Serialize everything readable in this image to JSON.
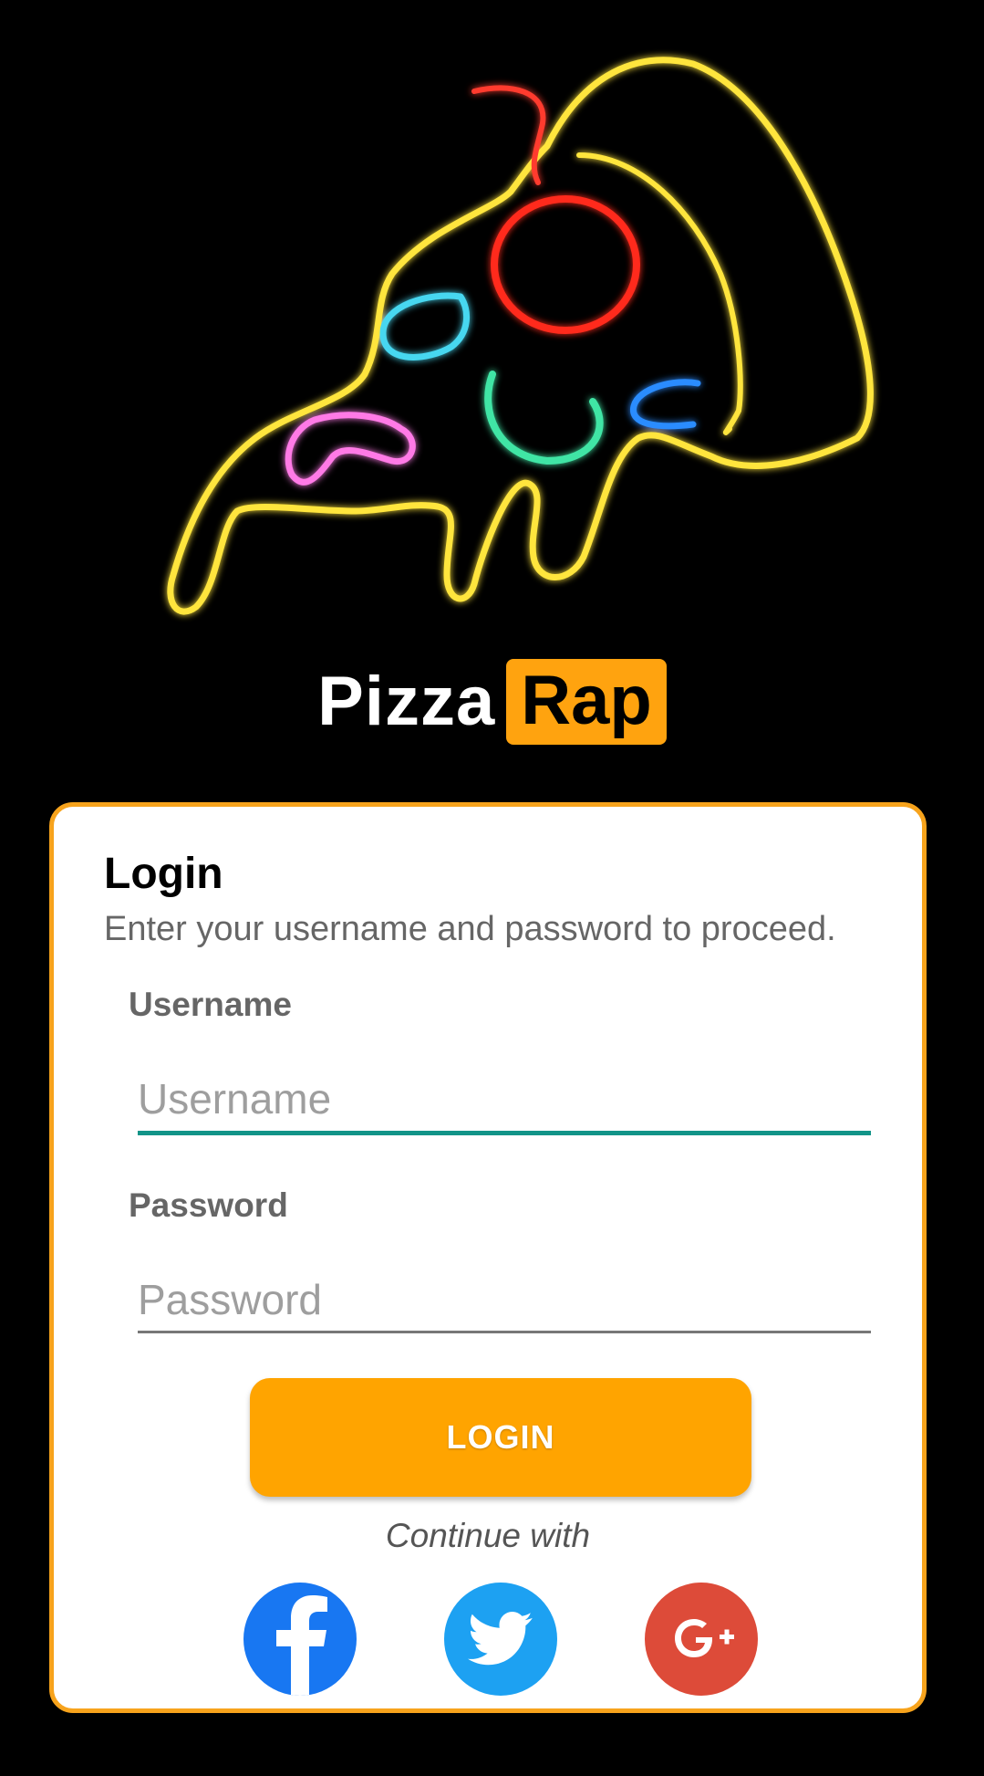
{
  "brand": {
    "word1": "Pizza",
    "word2": "Rap",
    "accent_color": "#ffa30f"
  },
  "login": {
    "title": "Login",
    "subtitle": "Enter your username and password to proceed.",
    "username_label": "Username",
    "username_placeholder": "Username",
    "username_value": "",
    "password_label": "Password",
    "password_placeholder": "Password",
    "password_value": "",
    "button_label": "LOGIN",
    "button_color": "#ffa400",
    "focus_color": "#129488"
  },
  "social": {
    "continue_label": "Continue with",
    "providers": [
      {
        "icon": "facebook-icon",
        "color": "#1877f2"
      },
      {
        "icon": "twitter-icon",
        "color": "#1da1f2"
      },
      {
        "icon": "google-plus-icon",
        "color": "#dd4b39"
      }
    ]
  }
}
